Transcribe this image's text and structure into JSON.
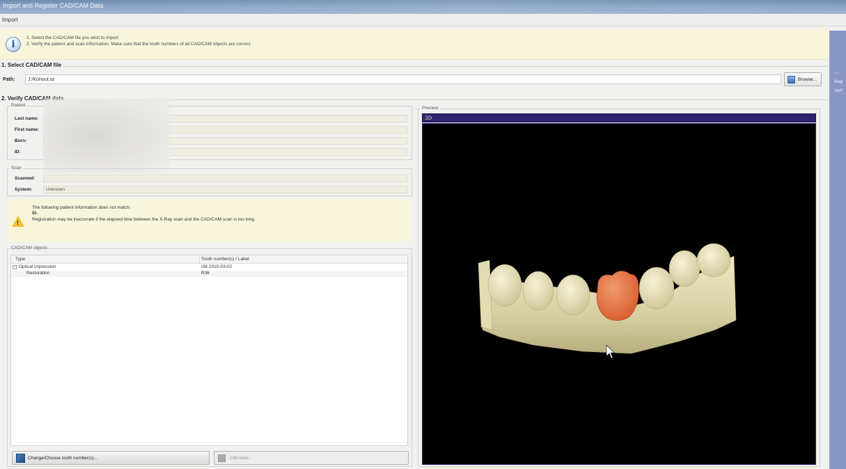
{
  "window": {
    "title": "Import and Register CAD/CAM Data"
  },
  "menu": {
    "import_label": "Import"
  },
  "info": {
    "icon": "info-icon",
    "line1": "1. Select the CAD/CAM file you wish to import",
    "line2": "2. Verify the patient and scan information. Make sure that the tooth numbers of all CAD/CAM objects are correct."
  },
  "section1": {
    "title": "1. Select CAD/CAM file",
    "path_label": "Path:",
    "path_value": "J:/Kohout.ss",
    "browse_label": "Browse..."
  },
  "section2": {
    "title": "2. Verify CAD/CAM data"
  },
  "patient": {
    "group_label": "Patient",
    "last_name_label": "Last name:",
    "first_name_label": "First name:",
    "born_label": "Born:",
    "id_label": "ID:"
  },
  "scan": {
    "group_label": "Scan",
    "scanned_label": "Scanned:",
    "scanned_value": "",
    "system_label": "System:",
    "system_value": "Unknown"
  },
  "warning": {
    "icon": "warning-icon",
    "line1": "The following patient information does not match:",
    "line2": "ID.",
    "line3": "Registration may be inaccurate if the elapsed time between the X-Ray scan and the CAD/CAM scan is too long."
  },
  "objects": {
    "group_label": "CAD/CAM objects",
    "col_type": "Type",
    "col_tooth": "Tooth number(s) / Label",
    "rows": [
      {
        "expander": "−",
        "type": "Optical impression",
        "tooth": "I36 2015-03-02"
      },
      {
        "type": "Restoration",
        "tooth": "R36"
      }
    ]
  },
  "buttons": {
    "change_tooth": "Change/Choose tooth number(s)...",
    "edit_label": "Edit label..."
  },
  "preview": {
    "group_label": "Preview",
    "tab_label": "3D"
  },
  "right_panel": {
    "arrow": "> I",
    "line1": "Regi",
    "line2": "Verif"
  },
  "colors": {
    "viewport_bg": "#000000",
    "preview_tab": "#2f2470",
    "model": "#e6e0b8",
    "restoration": "#e8754a",
    "banner": "#f7f6dc"
  }
}
